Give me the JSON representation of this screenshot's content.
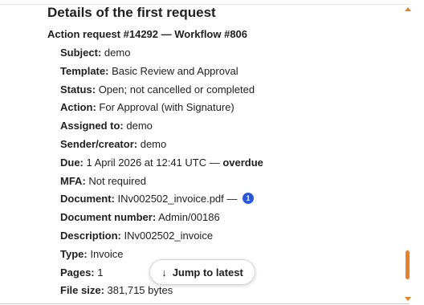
{
  "section": {
    "title": "Details of the first request",
    "request_line": "Action request #14292 — Workflow #806"
  },
  "fields": {
    "subject": {
      "label": "Subject:",
      "value": "demo"
    },
    "template": {
      "label": "Template:",
      "value": "Basic Review and Approval"
    },
    "status": {
      "label": "Status:",
      "value": "Open; not cancelled or completed"
    },
    "action": {
      "label": "Action:",
      "value": "For Approval (with Signature)"
    },
    "assigned_to": {
      "label": "Assigned to:",
      "value": "demo"
    },
    "sender": {
      "label": "Sender/creator:",
      "value": "demo"
    },
    "due": {
      "label": "Due:",
      "value": "1 April 2026 at 12:41 UTC —",
      "flag": "overdue"
    },
    "mfa": {
      "label": "MFA:",
      "value": "Not required"
    },
    "document": {
      "label": "Document:",
      "value": "INv002502_invoice.pdf —",
      "badge": "1"
    },
    "document_number": {
      "label": "Document number:",
      "value": "Admin/00186"
    },
    "description": {
      "label": "Description:",
      "value": "INv002502_invoice"
    },
    "type": {
      "label": "Type:",
      "value": "Invoice"
    },
    "pages": {
      "label": "Pages:",
      "value": "1"
    },
    "file_size": {
      "label": "File size:",
      "value": "381,715 bytes"
    }
  },
  "jump": {
    "icon": "arrow-down-icon",
    "glyph": "↓",
    "label": "Jump to latest"
  },
  "colors": {
    "accent_scroll": "#e8812a",
    "badge_blue": "#2b56d6"
  }
}
